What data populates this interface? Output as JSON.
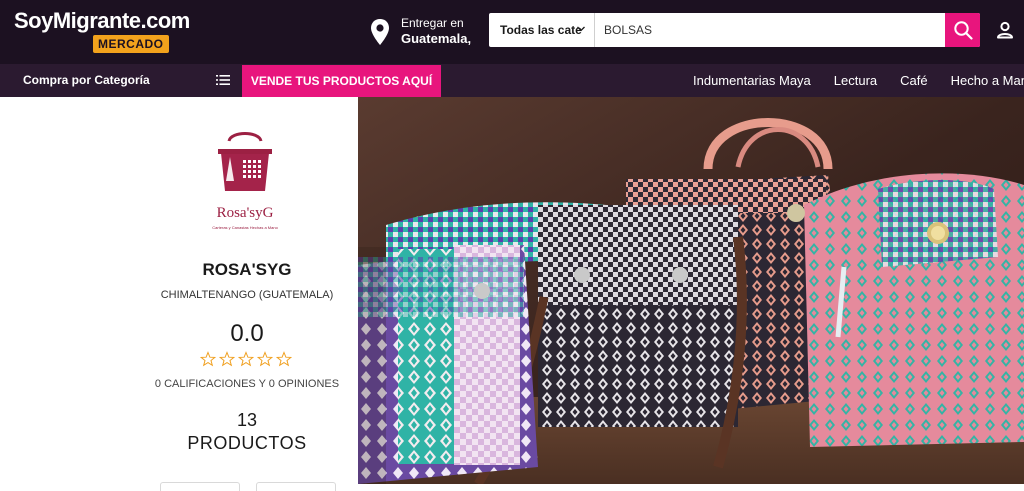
{
  "header": {
    "logo_main": "SoyMigrante.com",
    "logo_sub": "MERCADO",
    "deliver_label": "Entregar en",
    "deliver_location": "Guatemala,",
    "search": {
      "category": "Todas las cate",
      "value": "BOLSAS",
      "button_icon": "search-icon"
    },
    "account_icon": "user-icon"
  },
  "nav": {
    "categories_label": "Compra por Categoría",
    "menu_icon": "list-icon",
    "sell_label": "VENDE TUS PRODUCTOS AQUÍ",
    "links": [
      "Indumentarias Maya",
      "Lectura",
      "Café",
      "Hecho a Mano"
    ]
  },
  "store": {
    "logo_text": "Rosa'syG",
    "logo_tagline": "Carteras y Canastas Hechas a Mano",
    "name": "ROSA'SYG",
    "location": "CHIMALTENANGO (GUATEMALA)",
    "rating": "0.0",
    "stars_filled": 0,
    "stars_total": 5,
    "reviews": "0 CALIFICACIONES Y 0 OPINIONES",
    "products_count": "13",
    "products_label": "PRODUCTOS"
  },
  "banner": {
    "subject": "woven-handbags-photo"
  },
  "colors": {
    "header_bg": "#1c1121",
    "nav_bg": "#2b1a30",
    "accent_pink": "#e8157d",
    "logo_orange": "#f2a21c",
    "brand_maroon": "#9c2043",
    "star_outline": "#f0a020"
  }
}
